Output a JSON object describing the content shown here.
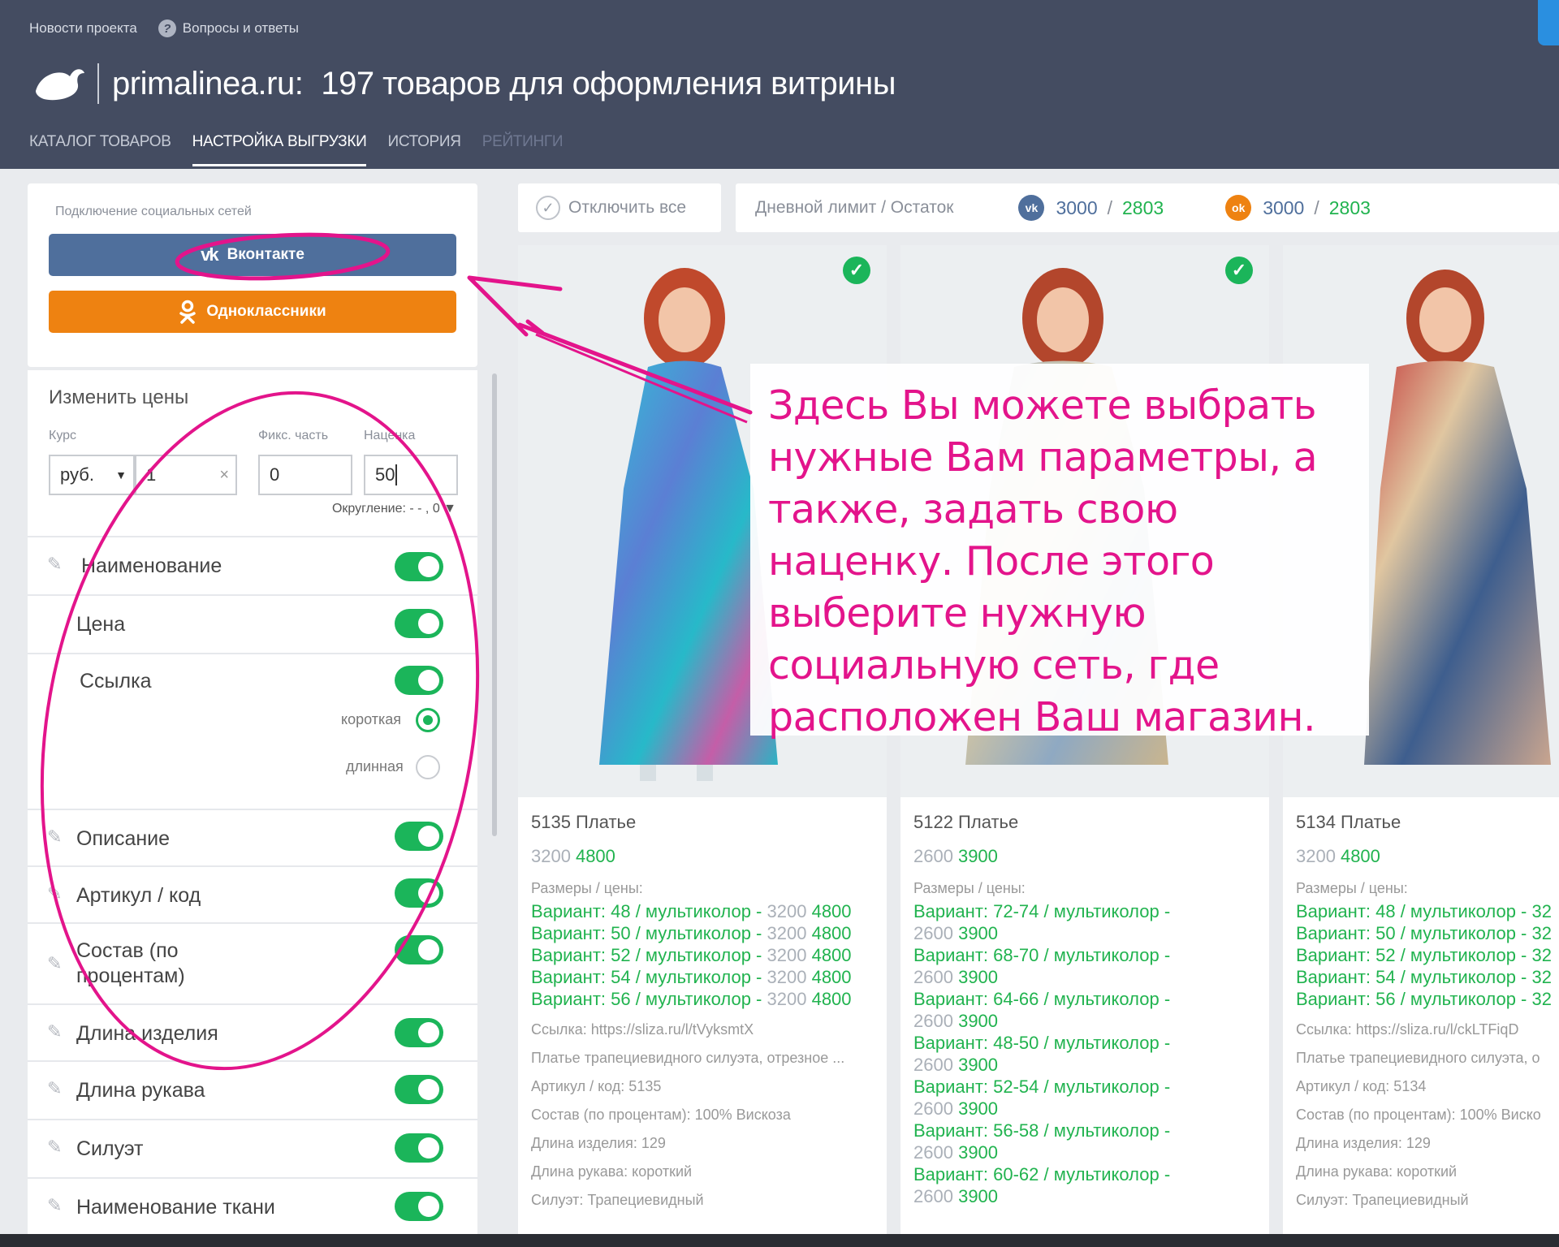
{
  "header": {
    "links": [
      "Новости проекта",
      "Вопросы и ответы"
    ],
    "help_icon_glyph": "?",
    "domain": "primalinea.ru:",
    "title": "197 товаров для оформления витрины",
    "tabs": [
      {
        "label": "КАТАЛОГ ТОВАРОВ",
        "state": "normal"
      },
      {
        "label": "НАСТРОЙКА ВЫГРУЗКИ",
        "state": "active"
      },
      {
        "label": "ИСТОРИЯ",
        "state": "normal"
      },
      {
        "label": "РЕЙТИНГИ",
        "state": "disabled"
      }
    ]
  },
  "social": {
    "caption": "Подключение социальных сетей",
    "vk_label": "Вконтакте",
    "ok_label": "Одноклассники",
    "vk_color": "#4f6f9c",
    "ok_color": "#ee8211"
  },
  "prices": {
    "title": "Изменить цены",
    "rate_label": "Курс",
    "fixed_label": "Фикс. часть",
    "markup_label": "Наценка",
    "currency": "руб.",
    "rate_value": "1",
    "fixed_value": "0",
    "markup_value": "50",
    "rounding": "Округление: - - , 0 ▼"
  },
  "options": [
    {
      "label": "Наименование",
      "on": true
    },
    {
      "label": "Цена",
      "on": true
    },
    {
      "label": "Ссылка",
      "on": true
    },
    {
      "label": "Описание",
      "on": true
    },
    {
      "label": "Артикул / код",
      "on": true
    },
    {
      "label": "Состав (по процентам)",
      "on": true
    },
    {
      "label": "Длина изделия",
      "on": true
    },
    {
      "label": "Длина рукава",
      "on": true
    },
    {
      "label": "Силуэт",
      "on": true
    },
    {
      "label": "Наименование ткани",
      "on": true
    }
  ],
  "link_types": {
    "short": "короткая",
    "long": "длинная",
    "selected": "short"
  },
  "toolbar": {
    "disable_all": "Отключить все",
    "limit_label": "Дневной лимит / Остаток",
    "vk_limit": "3000",
    "vk_rest": "2803",
    "ok_limit": "3000",
    "ok_rest": "2803"
  },
  "products": [
    {
      "title": "5135 Платье",
      "old_price": "3200",
      "new_price": "4800",
      "checked": true,
      "sizes_label": "Размеры / цены:",
      "variants": [
        [
          "Вариант: 48 / мультиколор - ",
          "3200",
          "4800"
        ],
        [
          "Вариант: 50 / мультиколор - ",
          "3200",
          "4800"
        ],
        [
          "Вариант: 52 / мультиколор - ",
          "3200",
          "4800"
        ],
        [
          "Вариант: 54 / мультиколор - ",
          "3200",
          "4800"
        ],
        [
          "Вариант: 56 / мультиколор - ",
          "3200",
          "4800"
        ]
      ],
      "lines": [
        "Ссылка: https://sliza.ru/l/tVyksmtX",
        "Платье трапециевидного силуэта, отрезное ...",
        "Артикул / код: 5135",
        "Состав (по процентам): 100% Вискоза",
        "Длина изделия: 129",
        "Длина рукава: короткий",
        "Силуэт: Трапециевидный"
      ]
    },
    {
      "title": "5122 Платье",
      "old_price": "2600",
      "new_price": "3900",
      "checked": true,
      "sizes_label": "Размеры / цены:",
      "variants_wrapped": [
        [
          "Вариант: 72-74 / мультиколор -",
          "2600",
          "3900"
        ],
        [
          "Вариант: 68-70 / мультиколор -",
          "2600",
          "3900"
        ],
        [
          "Вариант: 64-66 / мультиколор -",
          "2600",
          "3900"
        ],
        [
          "Вариант: 48-50 / мультиколор -",
          "2600",
          "3900"
        ],
        [
          "Вариант: 52-54 / мультиколор -",
          "2600",
          "3900"
        ],
        [
          "Вариант: 56-58 / мультиколор -",
          "2600",
          "3900"
        ],
        [
          "Вариант: 60-62 / мультиколор -",
          "2600",
          "3900"
        ]
      ]
    },
    {
      "title": "5134 Платье",
      "old_price": "3200",
      "new_price": "4800",
      "checked": false,
      "sizes_label": "Размеры / цены:",
      "variants": [
        [
          "Вариант: 48 / мультиколор - 32",
          "",
          ""
        ],
        [
          "Вариант: 50 / мультиколор - 32",
          "",
          ""
        ],
        [
          "Вариант: 52 / мультиколор - 32",
          "",
          ""
        ],
        [
          "Вариант: 54 / мультиколор - 32",
          "",
          ""
        ],
        [
          "Вариант: 56 / мультиколор - 32",
          "",
          ""
        ]
      ],
      "lines": [
        "Ссылка: https://sliza.ru/l/ckLTFiqD",
        "Платье трапециевидного силуэта, о",
        "Артикул / код: 5134",
        "Состав (по процентам): 100% Виско",
        "Длина изделия: 129",
        "Длина рукава: короткий",
        "Силуэт: Трапециевидный"
      ]
    }
  ],
  "annotation_text": "Здесь Вы можете выбрать нужные Вам параметры, а также, задать свою наценку. После этого выберите нужную социальную сеть, где расположен Ваш магазин.",
  "colors": {
    "accent_green": "#1bb55a",
    "header_bg": "#444c61",
    "annotation_magenta": "#e3148b"
  }
}
